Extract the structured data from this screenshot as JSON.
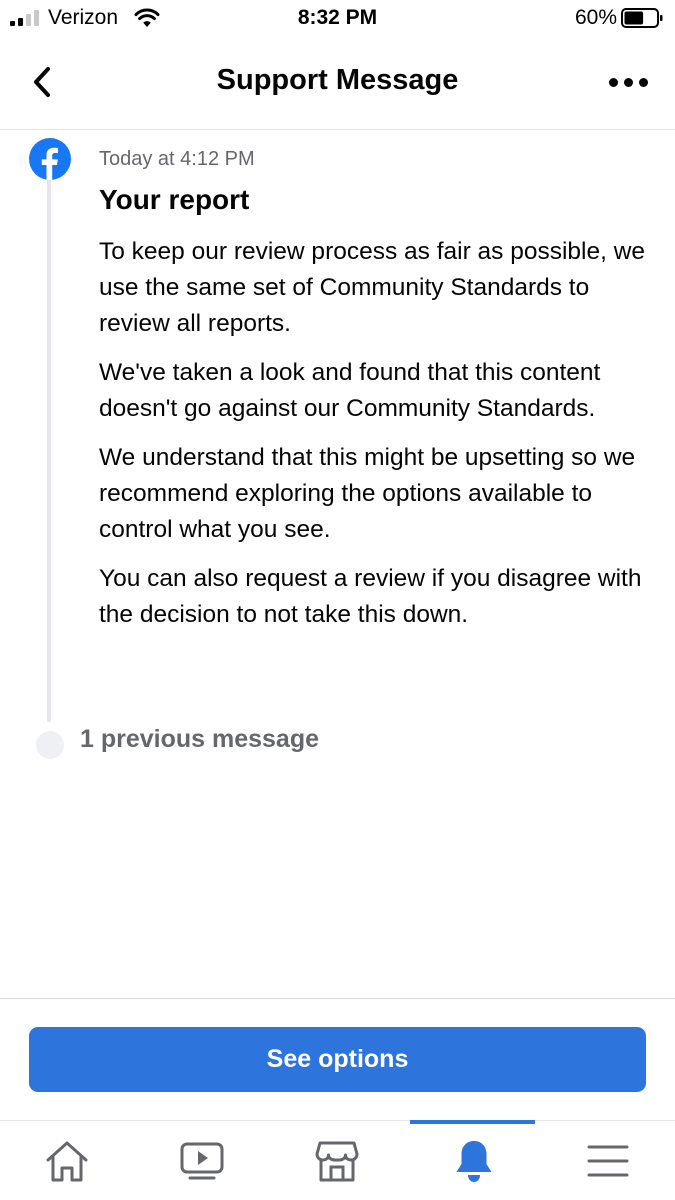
{
  "status_bar": {
    "carrier": "Verizon",
    "time": "8:32 PM",
    "battery_percent": "60%",
    "battery_level": 0.6
  },
  "header": {
    "title": "Support Message"
  },
  "message": {
    "timestamp": "Today at 4:12 PM",
    "title": "Your report",
    "paragraphs": [
      "To keep our review process as fair as possible, we use the same set of Community Standards to review all reports.",
      "We've taken a look and found that this content doesn't go against our Community Standards.",
      "We understand that this might be upsetting so we recommend exploring the options available to control what you see.",
      "You can also request a review if you disagree with the decision to not take this down."
    ]
  },
  "previous_messages": {
    "label": "1 previous message"
  },
  "action": {
    "see_options_label": "See options"
  },
  "tab_bar": {
    "tabs": [
      {
        "icon": "home-icon",
        "active": false
      },
      {
        "icon": "watch-icon",
        "active": false
      },
      {
        "icon": "marketplace-icon",
        "active": false
      },
      {
        "icon": "bell-icon",
        "active": true
      },
      {
        "icon": "menu-icon",
        "active": false
      }
    ]
  },
  "colors": {
    "accent": "#2d74dd",
    "facebook_blue": "#1877f2",
    "muted_text": "#65676b"
  }
}
